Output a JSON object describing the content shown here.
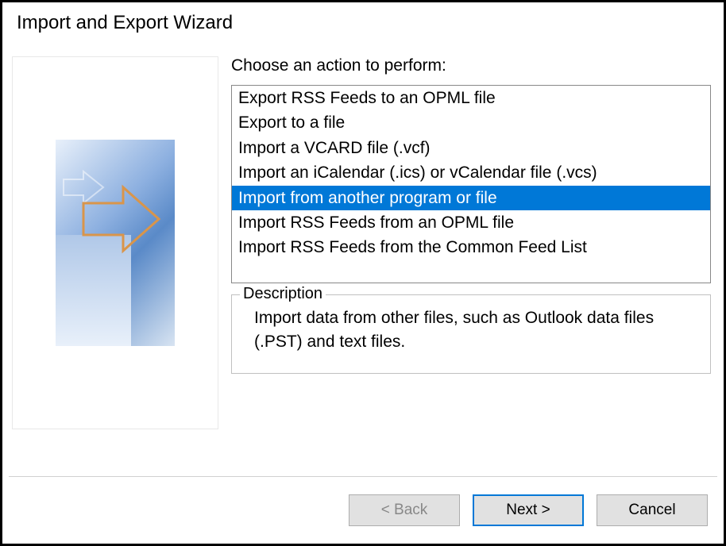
{
  "window": {
    "title": "Import and Export Wizard"
  },
  "prompt": "Choose an action to perform:",
  "actions": [
    {
      "label": "Export RSS Feeds to an OPML file",
      "selected": false
    },
    {
      "label": "Export to a file",
      "selected": false
    },
    {
      "label": "Import a VCARD file (.vcf)",
      "selected": false
    },
    {
      "label": "Import an iCalendar (.ics) or vCalendar file (.vcs)",
      "selected": false
    },
    {
      "label": "Import from another program or file",
      "selected": true
    },
    {
      "label": "Import RSS Feeds from an OPML file",
      "selected": false
    },
    {
      "label": "Import RSS Feeds from the Common Feed List",
      "selected": false
    }
  ],
  "description": {
    "legend": "Description",
    "text": "Import data from other files, such as Outlook data files (.PST) and text files."
  },
  "buttons": {
    "back": "< Back",
    "next": "Next >",
    "cancel": "Cancel"
  }
}
